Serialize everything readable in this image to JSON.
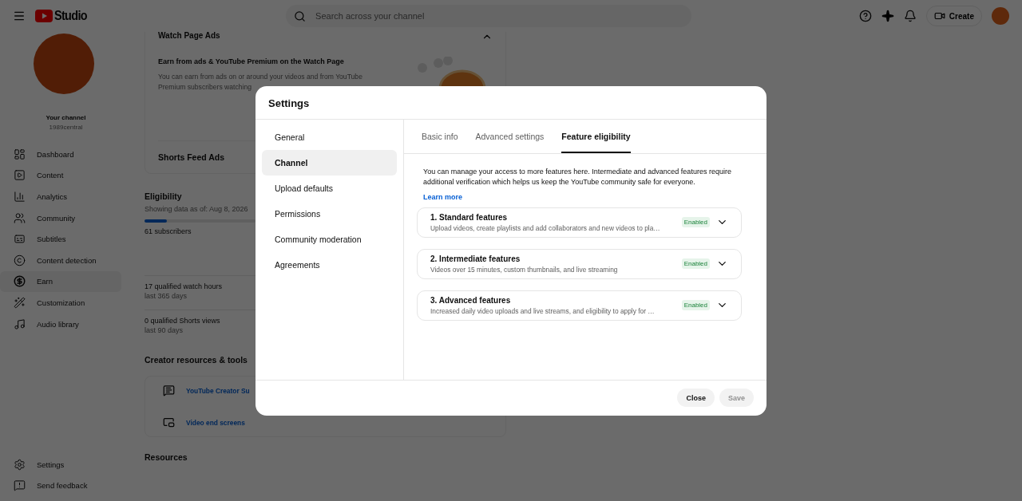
{
  "header": {
    "logo_text": "Studio",
    "search_placeholder": "Search across your channel",
    "create_label": "Create"
  },
  "sidebar": {
    "channel_label": "Your channel",
    "channel_handle": "1989central",
    "nav": [
      {
        "label": "Dashboard",
        "selected": false
      },
      {
        "label": "Content",
        "selected": false
      },
      {
        "label": "Analytics",
        "selected": false
      },
      {
        "label": "Community",
        "selected": false
      },
      {
        "label": "Subtitles",
        "selected": false
      },
      {
        "label": "Content detection",
        "selected": false
      },
      {
        "label": "Earn",
        "selected": true
      },
      {
        "label": "Customization",
        "selected": false
      },
      {
        "label": "Audio library",
        "selected": false
      }
    ],
    "bottom": [
      {
        "label": "Settings"
      },
      {
        "label": "Send feedback"
      }
    ]
  },
  "earn": {
    "watch_page_ads": {
      "title": "Watch Page Ads",
      "heading": "Earn from ads & YouTube Premium on the Watch Page",
      "description_lines": [
        "You can earn from ads on or around your videos and from YouTube",
        "Premium subscribers watching"
      ]
    },
    "shorts_feed_ads_title": "Shorts Feed Ads",
    "eligibility": {
      "title": "Eligibility",
      "date": "Showing data as of: Aug 8, 2026",
      "progress": {
        "level": 0.2
      },
      "subscribers": "61 subscribers",
      "watch_hours": "17 qualified watch hours",
      "watch_hours_period": "last 365 days",
      "shorts_views": "0 qualified Shorts views",
      "shorts_views_period": "last 90 days"
    },
    "creator_resources": {
      "title": "Creator resources & tools",
      "links": [
        {
          "label": "YouTube Creator Su"
        },
        {
          "label": "Video end screens"
        }
      ]
    },
    "resources_title": "Resources"
  },
  "modal": {
    "title": "Settings",
    "nav": [
      {
        "label": "General",
        "selected": false
      },
      {
        "label": "Channel",
        "selected": true
      },
      {
        "label": "Upload defaults",
        "selected": false
      },
      {
        "label": "Permissions",
        "selected": false
      },
      {
        "label": "Community moderation",
        "selected": false
      },
      {
        "label": "Agreements",
        "selected": false
      }
    ],
    "tabs": [
      {
        "label": "Basic info",
        "selected": false
      },
      {
        "label": "Advanced settings",
        "selected": false
      },
      {
        "label": "Feature eligibility",
        "selected": true
      }
    ],
    "intro": "You can manage your access to more features here. Intermediate and advanced features require additional verification which helps us keep the YouTube community safe for everyone.",
    "learn_more": "Learn more",
    "features": [
      {
        "title": "1. Standard features",
        "description": "Upload videos, create playlists and add collaborators and new videos to pla…",
        "status": "Enabled",
        "enabled": true,
        "expanded": false
      },
      {
        "title": "2. Intermediate features",
        "description": "Videos over 15 minutes, custom thumbnails, and live streaming",
        "status": "Enabled",
        "enabled": true,
        "expanded": false
      },
      {
        "title": "3. Advanced features",
        "description": "Increased daily video uploads and live streams, and eligibility to apply for …",
        "status": "Enabled",
        "enabled": true,
        "expanded": false
      }
    ],
    "buttons": [
      {
        "label": "Close",
        "disabled": false
      },
      {
        "label": "Save",
        "disabled": true
      }
    ]
  }
}
